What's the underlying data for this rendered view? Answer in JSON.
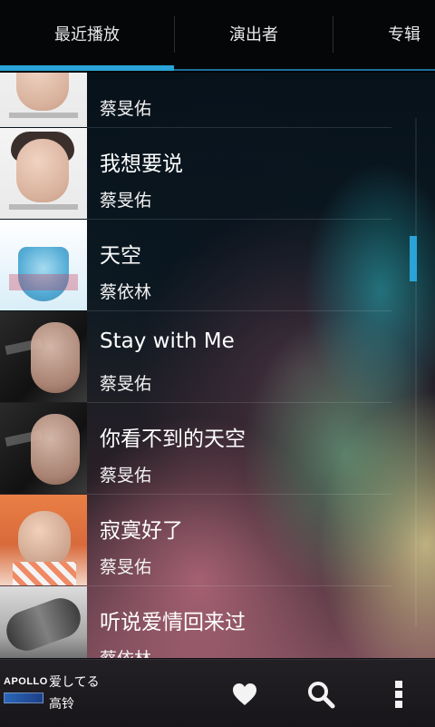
{
  "tabs": {
    "items": [
      {
        "label": "最近播放"
      },
      {
        "label": "演出者"
      },
      {
        "label": "专辑"
      }
    ]
  },
  "tracks": [
    {
      "title": "",
      "artist": "蔡旻佑",
      "cover": "white-portrait"
    },
    {
      "title": "我想要说",
      "artist": "蔡旻佑",
      "cover": "white-portrait"
    },
    {
      "title": "天空",
      "artist": "蔡依林",
      "cover": "sky-dress"
    },
    {
      "title": "Stay with Me",
      "artist": "蔡旻佑",
      "cover": "dark-portrait"
    },
    {
      "title": "你看不到的天空",
      "artist": "蔡旻佑",
      "cover": "dark-portrait"
    },
    {
      "title": "寂寞好了",
      "artist": "蔡旻佑",
      "cover": "orange-portrait"
    },
    {
      "title": "听说爱情回来过",
      "artist": "蔡依林",
      "cover": "bw-hand"
    }
  ],
  "now_playing": {
    "app_logo_text": "APOLLO",
    "title": "爱してる",
    "artist": "高铃"
  },
  "icons": {
    "favorite": "heart-icon",
    "search": "search-icon",
    "overflow": "overflow-menu-icon"
  },
  "colors": {
    "accent": "#2aa4d8",
    "tabs_bg": "#050608",
    "bottom_bg": "#1c191c"
  }
}
